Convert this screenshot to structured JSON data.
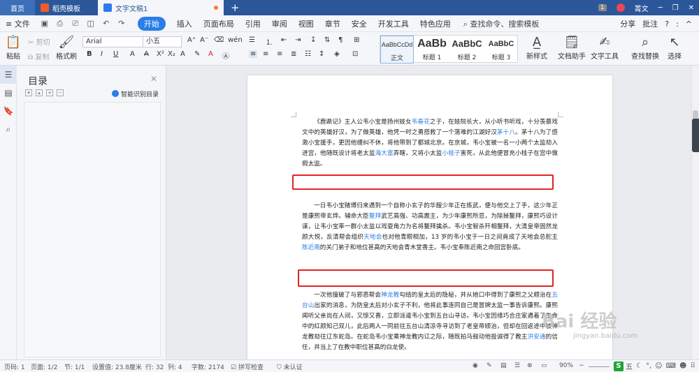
{
  "titlebar": {
    "tabs": [
      {
        "label": "首页"
      },
      {
        "label": "稻壳模板"
      },
      {
        "label": "文字文稿1"
      }
    ],
    "plus": "+",
    "page_count": "1",
    "user": "菁文",
    "window_controls": [
      "─",
      "❐",
      "✕"
    ]
  },
  "menubar": {
    "file": "≡ 文件",
    "items": [
      "开始",
      "插入",
      "页面布局",
      "引用",
      "审阅",
      "视图",
      "章节",
      "安全",
      "开发工具",
      "特色应用"
    ],
    "active": "开始",
    "search": "查找命令、搜索模板",
    "right": [
      "分享",
      "批注",
      "?",
      ":",
      "^"
    ]
  },
  "ribbon": {
    "paste": "粘贴",
    "cut": "剪切",
    "copy": "复制",
    "format_painter": "格式刷",
    "font_name": "Arial",
    "font_size": "小五",
    "styles": [
      {
        "sample": "AaBbCcDd",
        "label": "正文"
      },
      {
        "sample": "AaBb",
        "label": "标题 1"
      },
      {
        "sample": "AaBbC",
        "label": "标题 2"
      },
      {
        "sample": "AaBbC",
        "label": "标题 3"
      }
    ],
    "new_style": "新样式",
    "doc_helper": "文档助手",
    "text_tools": "文字工具",
    "find_replace": "查找替换",
    "select": "选择"
  },
  "toc": {
    "title": "目录",
    "smart": "智能识别目录"
  },
  "document": {
    "p1": [
      {
        "t": "《鹿鼎记》主人公韦小宝是扬州妓女"
      },
      {
        "t": "韦春花",
        "link": true
      },
      {
        "t": "之子，在妓院长大，从小听书听戏，十分羡慕戏文中的英雄好汉，为了做英雄，他凭一时之勇搭救了一个落难的江湖好汉"
      },
      {
        "t": "茅十八",
        "link": true
      },
      {
        "t": "。茅十八为了感激小宝援手，更因他缠纠不休，将他带到了都城北京。在京城，韦小宝被一名一小两个太监劫入进宫，他随既设计将老太监"
      },
      {
        "t": "海大富",
        "link": true
      },
      {
        "t": "弄瞎，又将小太监"
      },
      {
        "t": "小桂子",
        "link": true
      },
      {
        "t": "害死，从此他便冒充小桂子在宫中做假太监。"
      }
    ],
    "p2": [
      {
        "t": "一日韦小宝赌博归来遇到一个自称小玄子的华服少年正在练武，便与他交上了手，这少年正是康熙帝玄烨。辅命大臣"
      },
      {
        "t": "鳌拜",
        "link": true
      },
      {
        "t": "武艺高强、功高震主，为少年康熙所忌，为除掉鳌拜，康熙巧设计谋，让韦小宝率一群小太监以戏耍角力为名将鳌拜擒杀。韦小宝智杀歼相鳌拜，大清皇帝固然龙颜大悦，反清帮会组织"
      },
      {
        "t": "天地会",
        "link": true
      },
      {
        "t": "也对他青眼相加，13 岁的韦小宝于一日之间竟成了天地会总舵主"
      },
      {
        "t": "陈近南",
        "link": true
      },
      {
        "t": "的关门弟子和地位甚高的天地会青木堂香主。韦小宝奉陈近南之命回宫卧底。"
      }
    ],
    "p3": [
      {
        "t": "一次他撞破了与邪恶帮会"
      },
      {
        "t": "神龙教",
        "link": true
      },
      {
        "t": "勾结的皇太后的隐秘，并从她口中得到了康熙之父顺治在"
      },
      {
        "t": "五台山",
        "link": true
      },
      {
        "t": "出家的消息，为防皇太后对小玄子不利，他将此事连同自己是冒牌太监一事告诉康熙。康熙闻听父亲尚在人间，又惊又喜，立即派遣韦小宝到五台山寻访。韦小宝因缘巧合庄家遇着了生命中的红颜知己双儿，此后两人一同前往五台山清凉寺寻访到了老皇帝顺治，但却在回返途中被神龙教劫往辽东蛇岛。在蛇岛韦小宝乘神龙教内讧之际，随既拍马鼓动他投诚得了教主"
      },
      {
        "t": "洪安通",
        "link": true
      },
      {
        "t": "的信任，并当上了在教中职位甚高的白龙使。"
      }
    ]
  },
  "statusbar": {
    "page_no": "页码: 1",
    "page": "页面: 1/2",
    "section": "节: 1/1",
    "setting": "设置值: 23.8厘米",
    "row": "行: 32",
    "col": "列: 4",
    "words": "字数: 2174",
    "spell": "拼写检查",
    "cert": "未认证",
    "zoom": "90%",
    "ime": "五"
  },
  "watermark": {
    "main": "Bai 经验",
    "sub": "jingyan.baidu.com"
  },
  "colors": {
    "titlebar": "#2b579a",
    "accent": "#2b7de9",
    "link": "#2b7de9",
    "highlight_box": "#e02424"
  }
}
